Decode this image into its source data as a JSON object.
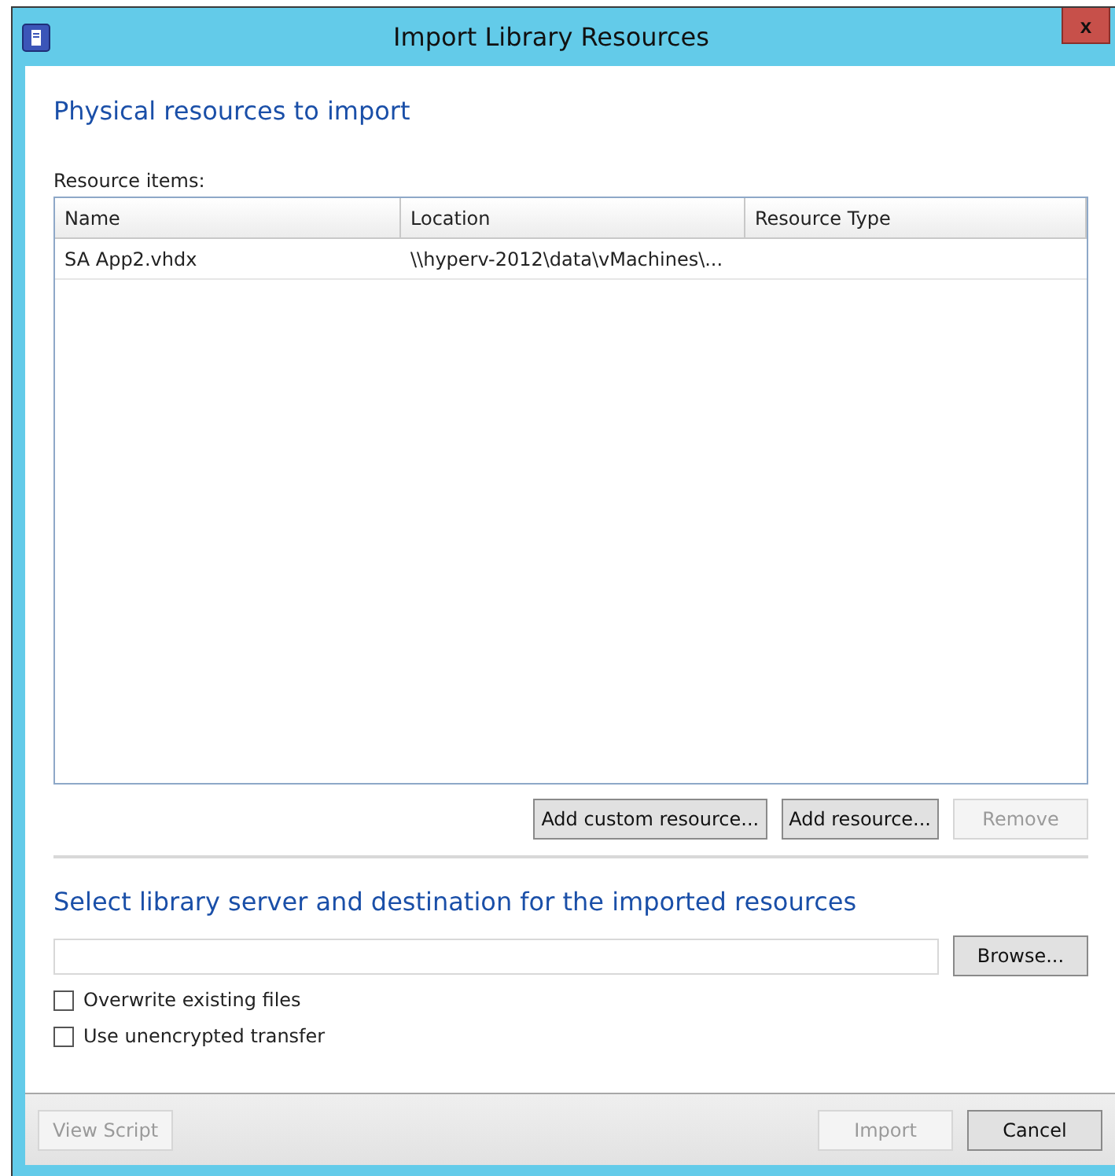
{
  "window": {
    "title": "Import Library Resources",
    "close_glyph": "x"
  },
  "resources_section": {
    "heading": "Physical resources to import",
    "label": "Resource items:",
    "table": {
      "columns": [
        "Name",
        "Location",
        "Resource Type"
      ],
      "rows": [
        {
          "cells": [
            "SA App2.vhdx",
            "\\\\hyperv-2012\\data\\vMachines\\...",
            ""
          ]
        }
      ]
    },
    "buttons": [
      {
        "label": "Add custom resource...",
        "disabled": false
      },
      {
        "label": "Add resource...",
        "disabled": false
      },
      {
        "label": "Remove",
        "disabled": true
      }
    ]
  },
  "destination_section": {
    "heading": "Select library server and destination for the imported resources",
    "browse_button": {
      "label": "Browse...",
      "disabled": false
    },
    "options": [
      {
        "label": "Overwrite existing files",
        "checked": false
      },
      {
        "label": "Use unencrypted transfer",
        "checked": false
      }
    ]
  },
  "footer": {
    "left_buttons": [
      {
        "label": "View Script",
        "disabled": true
      }
    ],
    "right_buttons": [
      {
        "label": "Import",
        "disabled": true
      },
      {
        "label": "Cancel",
        "disabled": false
      }
    ]
  }
}
